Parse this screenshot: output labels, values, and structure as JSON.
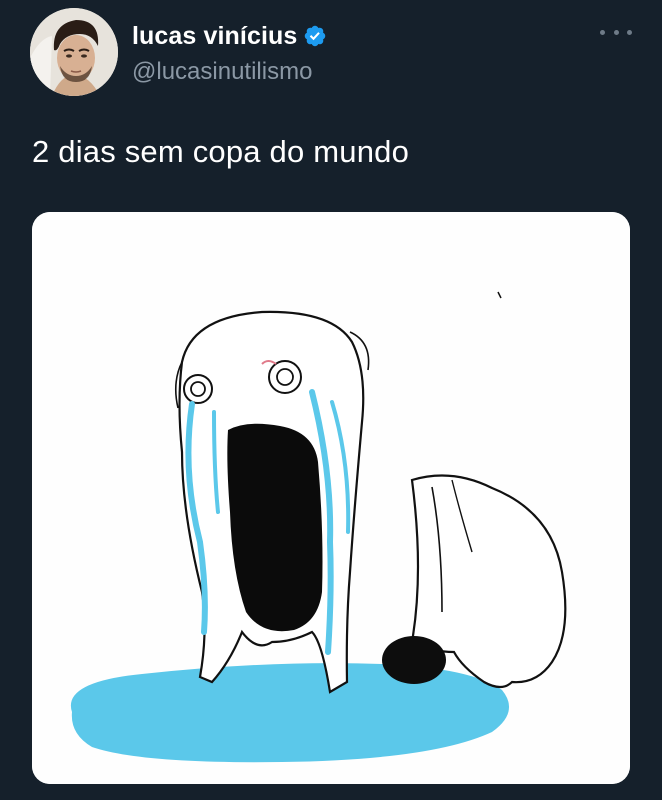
{
  "author": {
    "display_name": "lucas vinícius",
    "handle": "@lucasinutilismo",
    "verified": true,
    "avatar_icon": "user-avatar"
  },
  "tweet": {
    "text": "2 dias sem copa do mundo"
  },
  "media": {
    "kind": "meme-image",
    "description_icon": "crying-rage-face-meme"
  },
  "menu": {
    "icon": "more-options-icon"
  },
  "colors": {
    "background": "#15202b",
    "primary_text": "#ffffff",
    "secondary_text": "#8b98a5",
    "verified_blue": "#1d9bf0",
    "tears": "#5bc8ea"
  }
}
